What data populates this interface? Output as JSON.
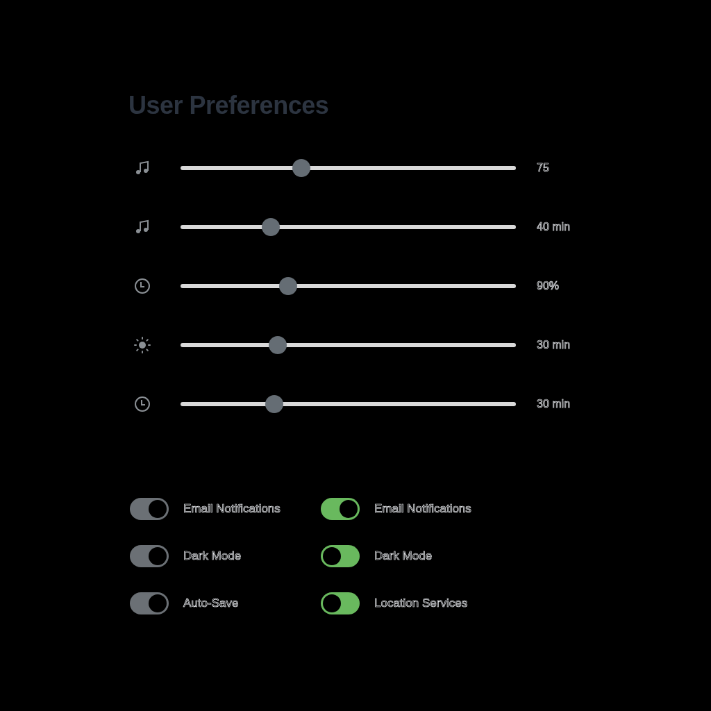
{
  "title": "User Preferences",
  "sliders": [
    {
      "level": 0.36,
      "reading": "75"
    },
    {
      "level": 0.27,
      "reading": "40 min"
    },
    {
      "level": 0.32,
      "reading": "90%"
    },
    {
      "level": 0.29,
      "reading": "30 min"
    },
    {
      "level": 0.28,
      "reading": "30 min"
    }
  ],
  "toggles": [
    {
      "label": "Email Notifications",
      "on": true,
      "color": "#6b7075"
    },
    {
      "label": "Email Notifications",
      "on": true,
      "color": "#69b95e"
    },
    {
      "label": "Dark Mode",
      "on": true,
      "color": "#6b7075"
    },
    {
      "label": "Dark Mode",
      "on": false,
      "color": "#69b95e"
    },
    {
      "label": "Auto-Save",
      "on": true,
      "color": "#6b7075"
    },
    {
      "label": "Location Services",
      "on": false,
      "color": "#69b95e"
    }
  ]
}
